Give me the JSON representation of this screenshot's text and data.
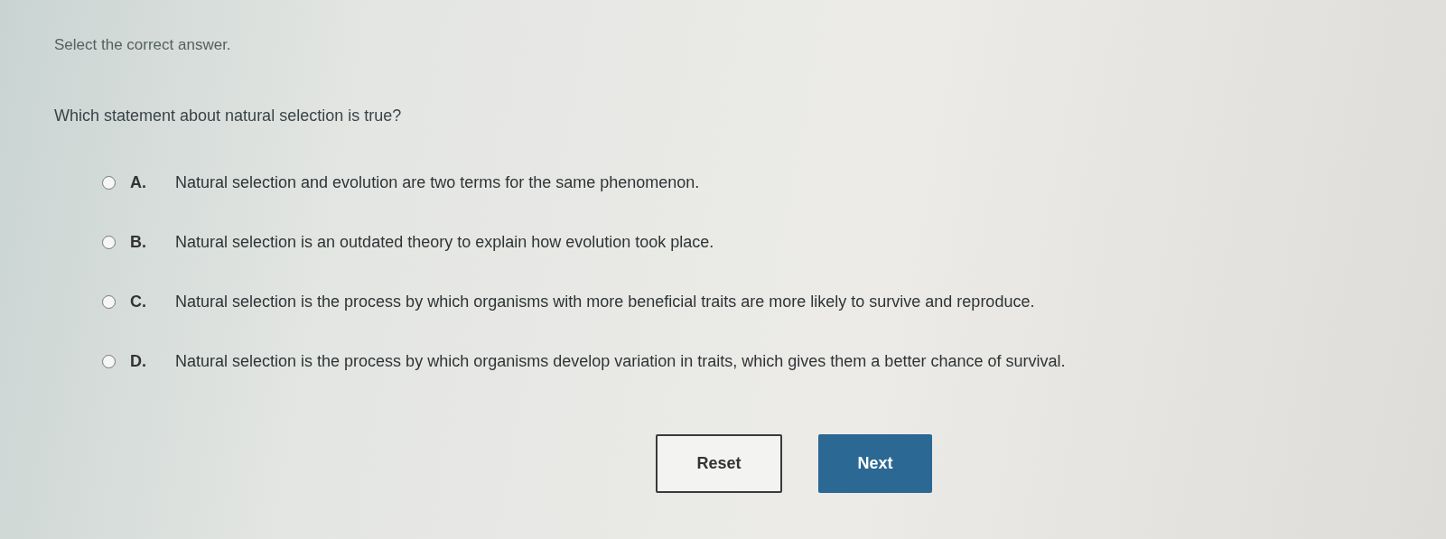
{
  "instruction": "Select the correct answer.",
  "question": "Which statement about natural selection is true?",
  "options": [
    {
      "letter": "A.",
      "text": "Natural selection and evolution are two terms for the same phenomenon.",
      "selected": false
    },
    {
      "letter": "B.",
      "text": "Natural selection is an outdated theory to explain how evolution took place.",
      "selected": false
    },
    {
      "letter": "C.",
      "text": "Natural selection is the process by which organisms with more beneficial traits are more likely to survive and reproduce.",
      "selected": false
    },
    {
      "letter": "D.",
      "text": "Natural selection is the process by which organisms develop variation in traits, which gives them a better chance of survival.",
      "selected": false
    }
  ],
  "buttons": [
    {
      "kind": "secondary",
      "label": "Reset"
    },
    {
      "kind": "primary",
      "label": "Next"
    }
  ]
}
